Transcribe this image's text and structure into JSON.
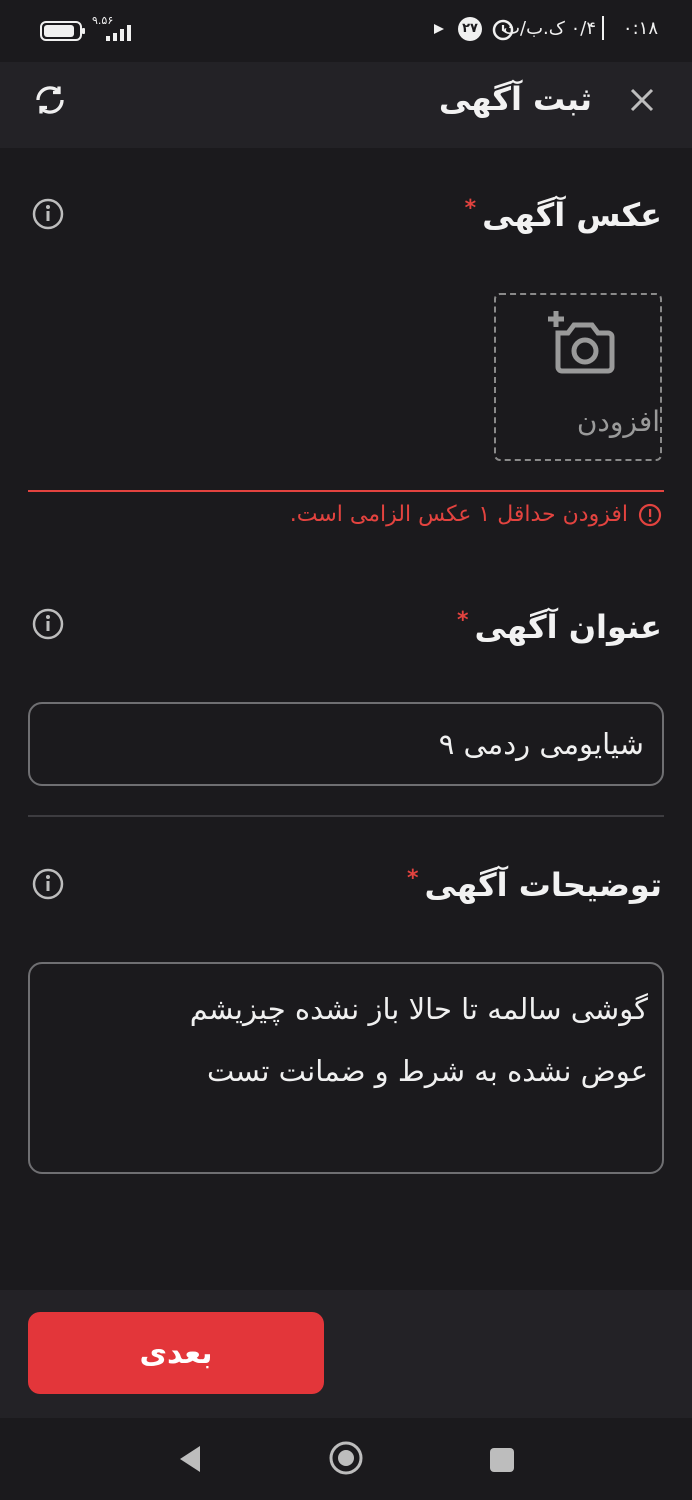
{
  "status_bar": {
    "time": "۰:۱۸",
    "date": "۰/۴ ک.ب/ث",
    "badge": "۲۷",
    "speed": "۹.۵۶"
  },
  "header": {
    "title": "ثبت آگهی",
    "close_icon": "close-icon",
    "refresh_icon": "refresh-icon"
  },
  "photo_section": {
    "title": "عکس آگهی",
    "required_mark": "*",
    "add_label": "افزودن",
    "error": "افزودن حداقل ۱ عکس الزامی است."
  },
  "title_section": {
    "title": "عنوان آگهی",
    "required_mark": "*",
    "value": "شیایومی ردمی ۹"
  },
  "description_section": {
    "title": "توضیحات آگهی",
    "required_mark": "*",
    "value": "گوشی سالمه تا حالا باز نشده چیزیشم\nعوض نشده به شرط و ضمانت تست"
  },
  "footer": {
    "next_label": "بعدی"
  },
  "colors": {
    "accent": "#e3363a",
    "background": "#1b1a1d",
    "header": "#232226"
  }
}
